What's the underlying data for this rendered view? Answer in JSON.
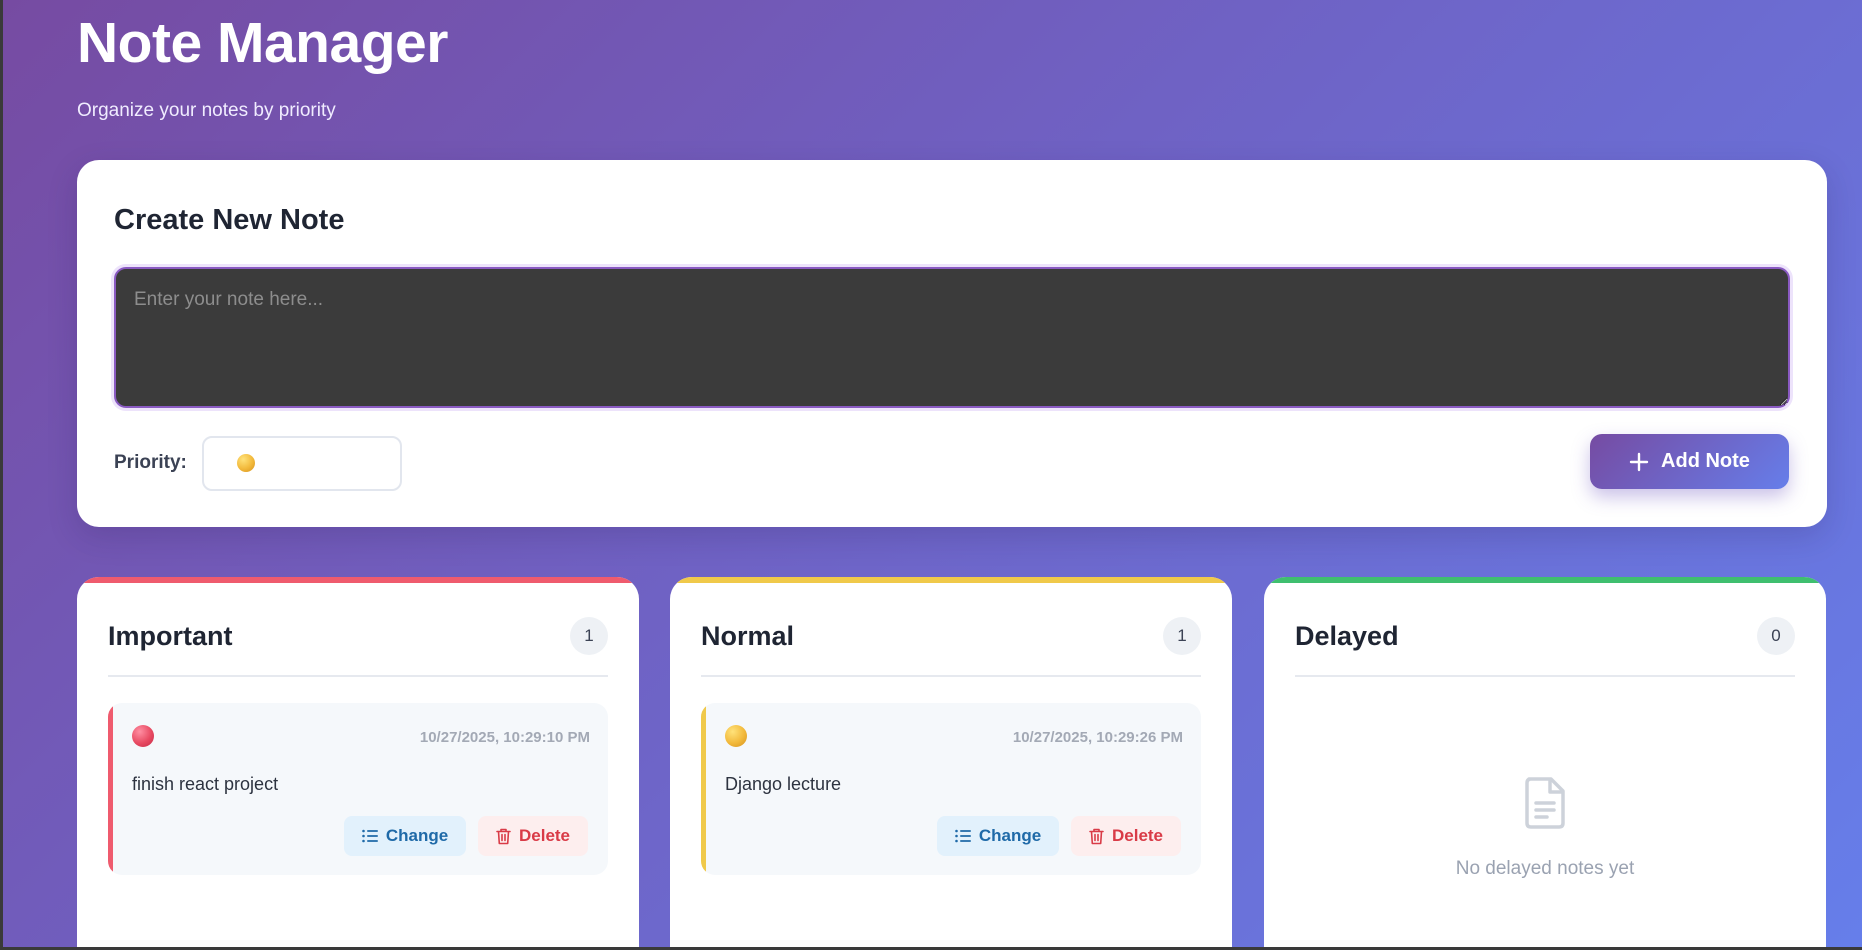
{
  "header": {
    "title": "Note Manager",
    "subtitle": "Organize your notes by priority"
  },
  "create": {
    "title": "Create New Note",
    "placeholder": "Enter your note here...",
    "priority_label": "Priority:",
    "priority_selected_icon": "yellow-dot-icon",
    "add_button": "Add Note"
  },
  "columns": [
    {
      "title": "Important",
      "count": "1",
      "accent": "#ef5b6e",
      "notes": [
        {
          "dot": "red-dot-icon",
          "time": "10/27/2025, 10:29:10 PM",
          "text": "finish react project",
          "change_label": "Change",
          "delete_label": "Delete"
        }
      ]
    },
    {
      "title": "Normal",
      "count": "1",
      "accent": "#f0c94a",
      "notes": [
        {
          "dot": "yellow-dot-icon",
          "time": "10/27/2025, 10:29:26 PM",
          "text": "Django lecture",
          "change_label": "Change",
          "delete_label": "Delete"
        }
      ]
    },
    {
      "title": "Delayed",
      "count": "0",
      "accent": "#3fbf6f",
      "empty_text": "No delayed notes yet"
    }
  ],
  "colors": {
    "gradient_start": "#764ba2",
    "gradient_end": "#667eea",
    "change": "#1f6aa8",
    "delete": "#d93b47"
  }
}
